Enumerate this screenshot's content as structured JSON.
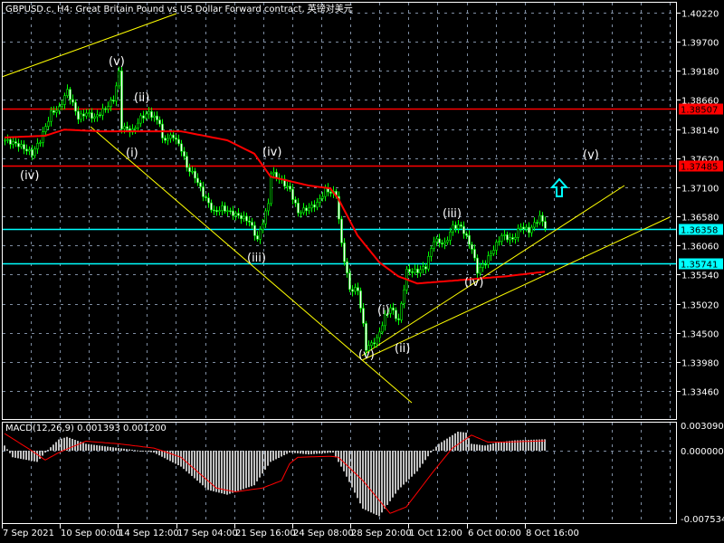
{
  "title": "GBPUSD.c, H4:  Great Britain Pound vs US Dollar Forward contract, 英镑对美元",
  "colors": {
    "background": "#000000",
    "grid": "#7f8ea3",
    "bull": "#00ff00",
    "ma": "#ff0000",
    "trend": "#ffff00",
    "hline_red": "#ff0000",
    "hline_cyan": "#00ffff",
    "macd_hist": "#c0c0c0",
    "macd_signal": "#ff0000"
  },
  "price_axis": {
    "ticks": [
      "1.40220",
      "1.39700",
      "1.39180",
      "1.38660",
      "1.38140",
      "1.37620",
      "1.37100",
      "1.36580",
      "1.36060",
      "1.35540",
      "1.35020",
      "1.34500",
      "1.33980",
      "1.33460"
    ],
    "max": 1.4022,
    "step": 0.0052
  },
  "horizontal_lines": [
    {
      "label": "1.38507",
      "price": 1.38507,
      "color": "#ff0000",
      "text_color": "#000000"
    },
    {
      "label": "1.37485",
      "price": 1.37485,
      "color": "#ff0000",
      "text_color": "#000000"
    },
    {
      "label": "1.36358",
      "price": 1.36358,
      "color": "#00ffff",
      "text_color": "#000000"
    },
    {
      "label": "1.35741",
      "price": 1.35741,
      "color": "#00ffff",
      "text_color": "#000000"
    }
  ],
  "time_axis": {
    "labels": [
      "7 Sep 2021",
      "10 Sep 00:00",
      "14 Sep 12:00",
      "17 Sep 04:00",
      "21 Sep 16:00",
      "24 Sep 08:00",
      "28 Sep 20:00",
      "1 Oct 12:00",
      "6 Oct 00:00",
      "8 Oct 16:00"
    ]
  },
  "wave_labels": [
    "(v)",
    "(ii)",
    "(i)",
    "(iv)",
    "(iv)",
    "(iii)",
    "(iii)",
    "(iv)",
    "(i)",
    "(ii)",
    "(v)",
    "(v)"
  ],
  "macd": {
    "label": "MACD(12,26,9) 0.001393 0.001200",
    "axis": [
      "0.003090",
      "0.000000",
      "-0.007534"
    ],
    "max": 0.00309,
    "min": -0.007534
  },
  "chart_data": {
    "type": "candlestick",
    "symbol": "GBPUSD.c",
    "timeframe": "H4",
    "bars": 200,
    "price_keyframes": [
      [
        0,
        1.3794
      ],
      [
        5,
        1.3786
      ],
      [
        10,
        1.377
      ],
      [
        13,
        1.3794
      ],
      [
        17,
        1.3843
      ],
      [
        20,
        1.3851
      ],
      [
        23,
        1.3883
      ],
      [
        27,
        1.3834
      ],
      [
        30,
        1.3843
      ],
      [
        33,
        1.3834
      ],
      [
        37,
        1.3851
      ],
      [
        40,
        1.3867
      ],
      [
        42,
        1.3915
      ],
      [
        43,
        1.3818
      ],
      [
        47,
        1.381
      ],
      [
        50,
        1.3834
      ],
      [
        53,
        1.3843
      ],
      [
        57,
        1.3826
      ],
      [
        58,
        1.3794
      ],
      [
        62,
        1.3802
      ],
      [
        65,
        1.3778
      ],
      [
        67,
        1.3746
      ],
      [
        70,
        1.3729
      ],
      [
        73,
        1.3697
      ],
      [
        77,
        1.3665
      ],
      [
        80,
        1.3673
      ],
      [
        83,
        1.3665
      ],
      [
        87,
        1.3657
      ],
      [
        90,
        1.3649
      ],
      [
        93,
        1.3616
      ],
      [
        97,
        1.3681
      ],
      [
        98,
        1.3737
      ],
      [
        102,
        1.3721
      ],
      [
        105,
        1.3705
      ],
      [
        108,
        1.3665
      ],
      [
        112,
        1.3673
      ],
      [
        115,
        1.3681
      ],
      [
        118,
        1.3705
      ],
      [
        122,
        1.3697
      ],
      [
        124,
        1.3608
      ],
      [
        127,
        1.3527
      ],
      [
        130,
        1.3527
      ],
      [
        132,
        1.3463
      ],
      [
        133,
        1.3422
      ],
      [
        137,
        1.3438
      ],
      [
        140,
        1.3479
      ],
      [
        142,
        1.3495
      ],
      [
        145,
        1.3471
      ],
      [
        148,
        1.356
      ],
      [
        152,
        1.356
      ],
      [
        155,
        1.3568
      ],
      [
        158,
        1.3616
      ],
      [
        162,
        1.3608
      ],
      [
        165,
        1.364
      ],
      [
        168,
        1.364
      ],
      [
        172,
        1.36
      ],
      [
        174,
        1.356
      ],
      [
        177,
        1.3576
      ],
      [
        180,
        1.36
      ],
      [
        183,
        1.3624
      ],
      [
        187,
        1.3616
      ],
      [
        190,
        1.364
      ],
      [
        193,
        1.3632
      ],
      [
        197,
        1.3657
      ],
      [
        199,
        1.364
      ]
    ],
    "ma_keyframes": [
      [
        0,
        1.3799
      ],
      [
        15,
        1.3802
      ],
      [
        22,
        1.3813
      ],
      [
        35,
        1.381
      ],
      [
        65,
        1.381
      ],
      [
        82,
        1.3794
      ],
      [
        92,
        1.377
      ],
      [
        98,
        1.3729
      ],
      [
        112,
        1.3713
      ],
      [
        120,
        1.3708
      ],
      [
        123,
        1.3689
      ],
      [
        130,
        1.3624
      ],
      [
        138,
        1.3576
      ],
      [
        145,
        1.3551
      ],
      [
        152,
        1.3538
      ],
      [
        165,
        1.3543
      ],
      [
        185,
        1.3551
      ],
      [
        199,
        1.3559
      ]
    ],
    "macd_hist_keyframes": [
      [
        0,
        0.00063
      ],
      [
        3,
        -0.00074
      ],
      [
        12,
        -0.00126
      ],
      [
        15,
        -0.00021
      ],
      [
        20,
        0.00137
      ],
      [
        23,
        0.00168
      ],
      [
        30,
        0.00084
      ],
      [
        42,
        0.00032
      ],
      [
        55,
        -0.00021
      ],
      [
        65,
        -0.00179
      ],
      [
        75,
        -0.00442
      ],
      [
        82,
        -0.00495
      ],
      [
        92,
        -0.00389
      ],
      [
        98,
        -0.00126
      ],
      [
        105,
        -0.00021
      ],
      [
        112,
        -0.00042
      ],
      [
        121,
        -0.00021
      ],
      [
        125,
        -0.00232
      ],
      [
        132,
        -0.00653
      ],
      [
        138,
        -0.00737
      ],
      [
        145,
        -0.00442
      ],
      [
        152,
        -0.00232
      ],
      [
        157,
        -0.00021
      ],
      [
        160,
        0.00084
      ],
      [
        167,
        0.00232
      ],
      [
        170,
        0.00221
      ],
      [
        172,
        0.00084
      ],
      [
        177,
        0.00063
      ],
      [
        182,
        0.00105
      ],
      [
        188,
        0.00126
      ],
      [
        199,
        0.001393
      ]
    ],
    "macd_signal_keyframes": [
      [
        0,
        0.0021
      ],
      [
        15,
        -0.00105
      ],
      [
        20,
        -0.00021
      ],
      [
        30,
        0.00116
      ],
      [
        42,
        0.00084
      ],
      [
        55,
        0.00032
      ],
      [
        65,
        -0.00074
      ],
      [
        78,
        -0.0042
      ],
      [
        85,
        -0.00463
      ],
      [
        95,
        -0.0042
      ],
      [
        102,
        -0.00337
      ],
      [
        105,
        -0.00147
      ],
      [
        108,
        -0.00074
      ],
      [
        120,
        -0.00063
      ],
      [
        123,
        -0.00074
      ],
      [
        132,
        -0.00337
      ],
      [
        142,
        -0.00705
      ],
      [
        148,
        -0.00632
      ],
      [
        158,
        -0.00232
      ],
      [
        165,
        0.00032
      ],
      [
        172,
        0.0019
      ],
      [
        178,
        0.00105
      ],
      [
        185,
        0.00105
      ],
      [
        199,
        0.0012
      ]
    ]
  }
}
